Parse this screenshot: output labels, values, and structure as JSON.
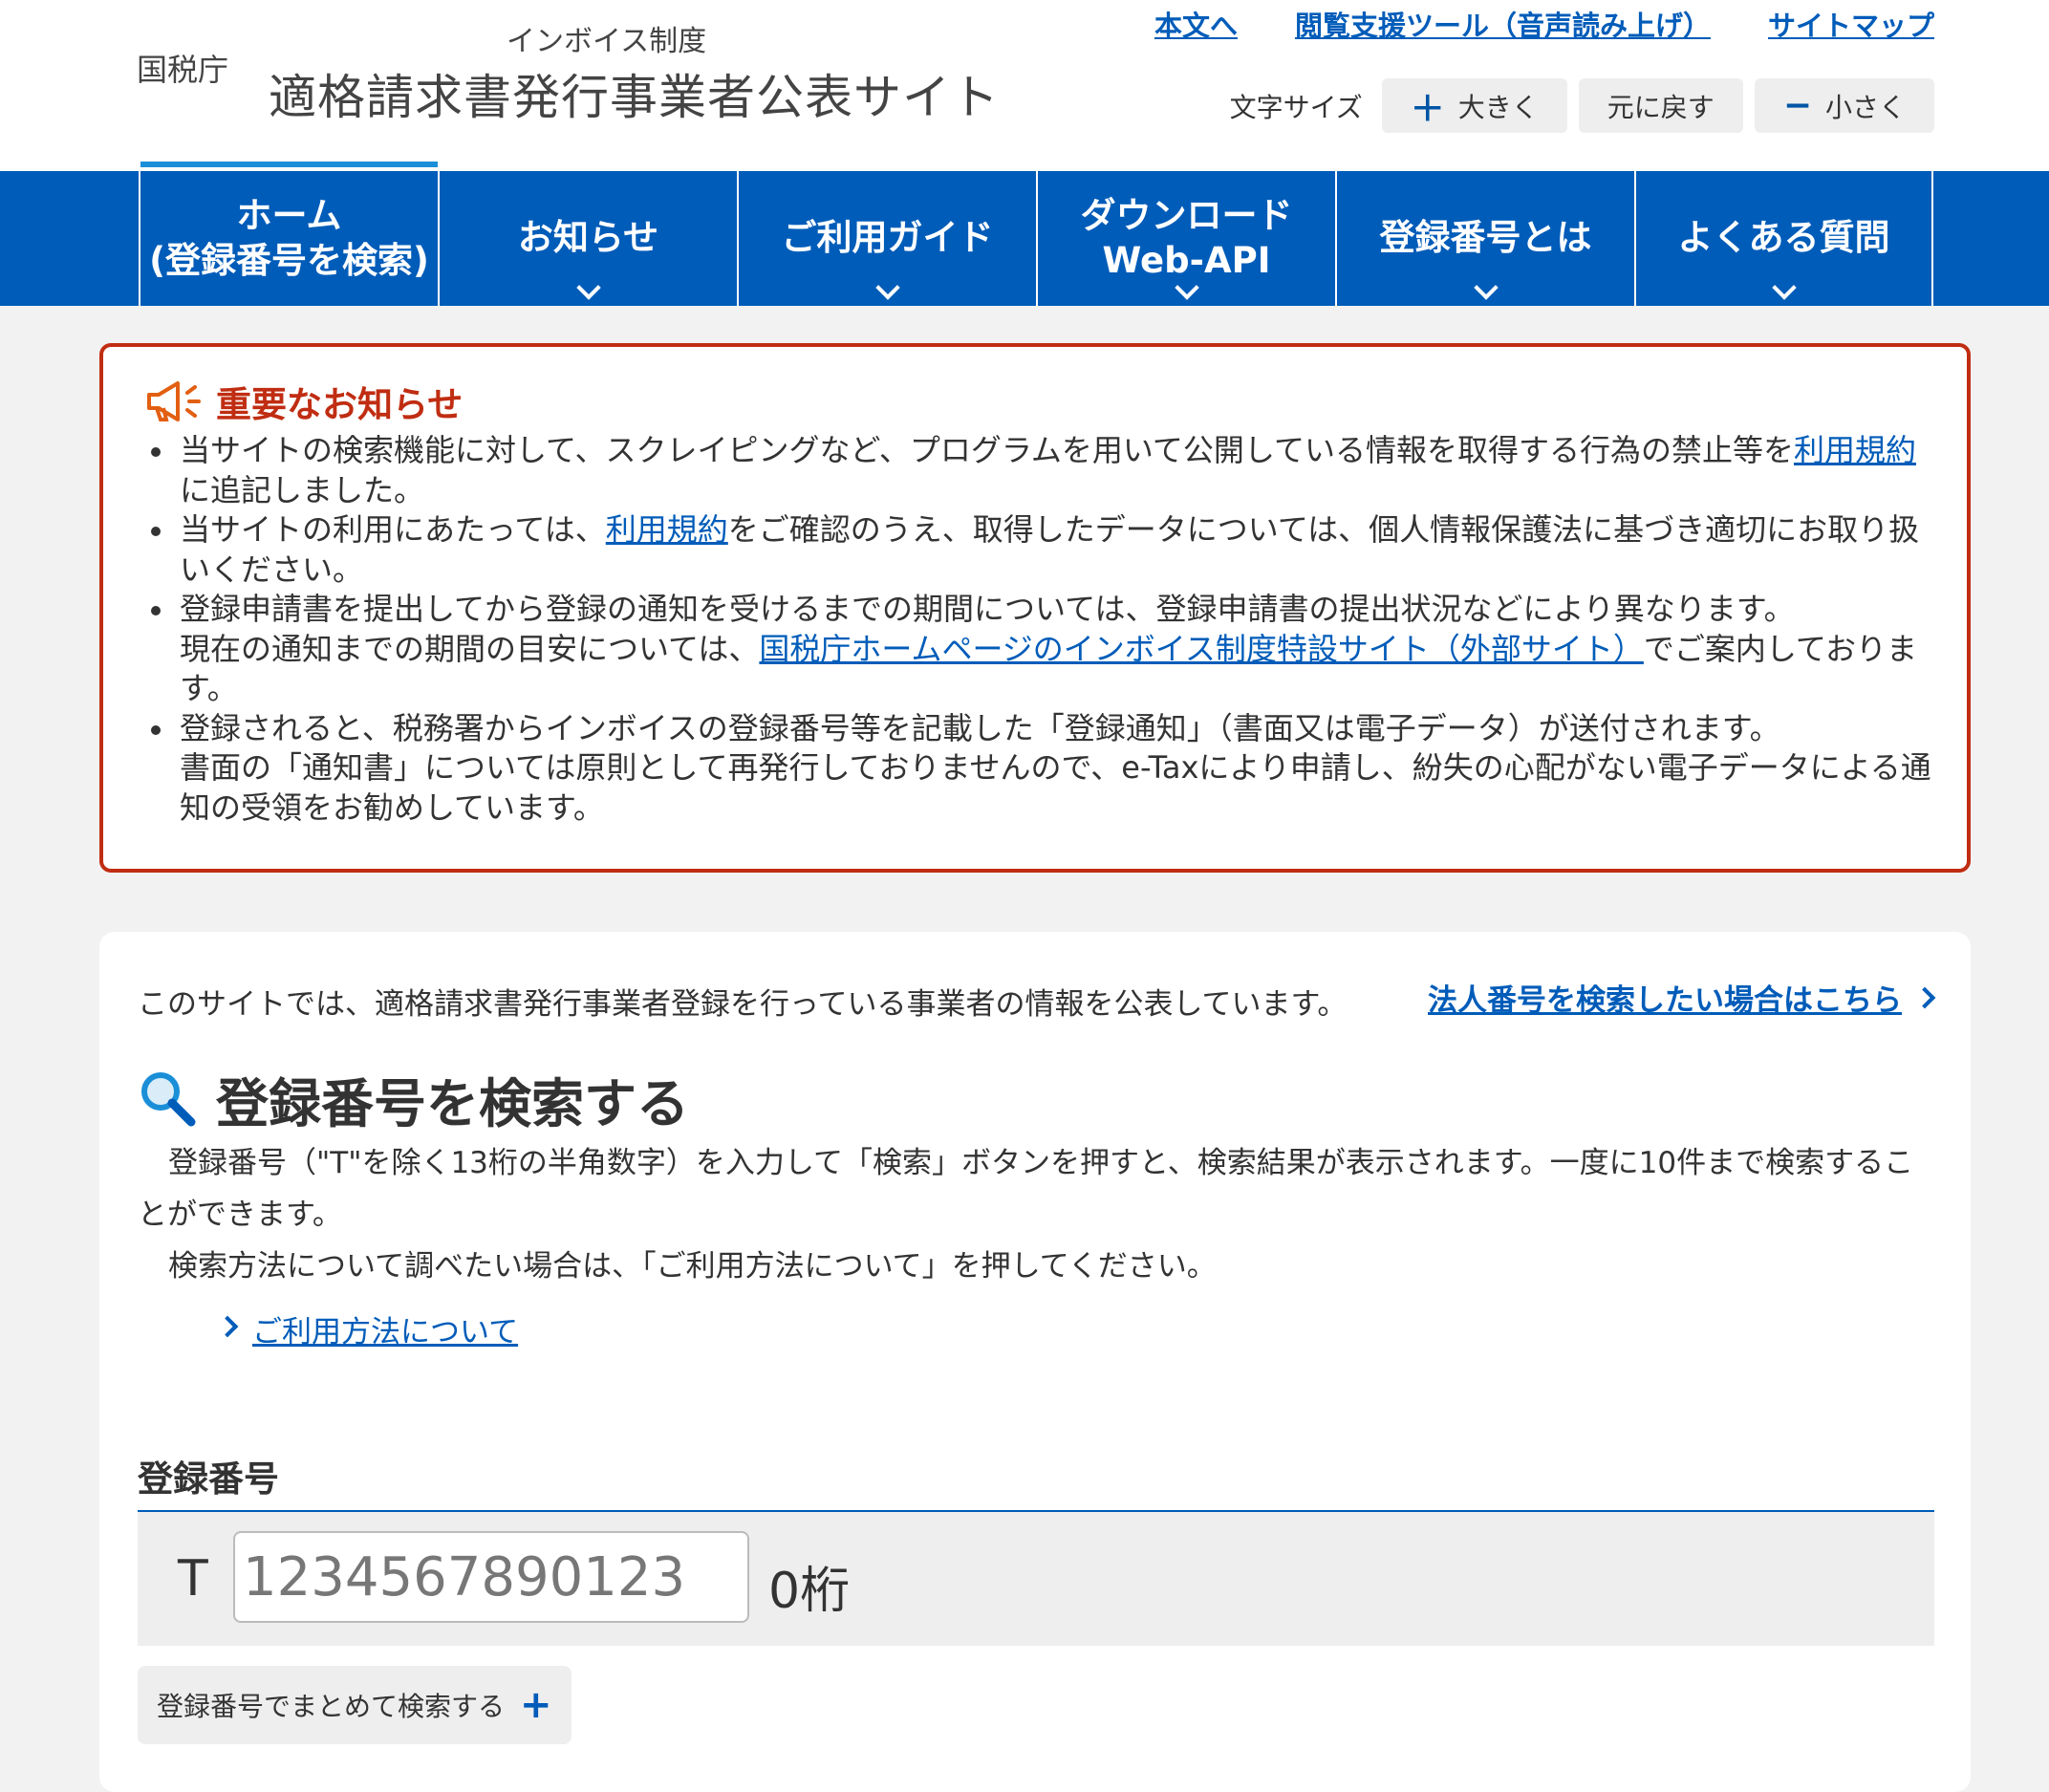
{
  "header": {
    "agency": "国税庁",
    "subtitle": "インボイス制度",
    "title": "適格請求書発行事業者公表サイト",
    "links": [
      "本文へ",
      "閲覧支援ツール（音声読み上げ）",
      "サイトマップ"
    ],
    "font_size": {
      "label": "文字サイズ",
      "larger": "大きく",
      "reset": "元に戻す",
      "smaller": "小さく"
    }
  },
  "nav": {
    "items": [
      {
        "line1": "ホーム",
        "line2": "(登録番号を検索)"
      },
      {
        "line1": "お知らせ",
        "line2": ""
      },
      {
        "line1": "ご利用ガイド",
        "line2": ""
      },
      {
        "line1": "ダウンロード",
        "line2": "Web-API"
      },
      {
        "line1": "登録番号とは",
        "line2": ""
      },
      {
        "line1": "よくある質問",
        "line2": ""
      }
    ]
  },
  "notice": {
    "title": "重要なお知らせ",
    "items": [
      {
        "pre": "当サイトの検索機能に対して、スクレイピングなど、プログラムを用いて公開している情報を取得する行為の禁止等を",
        "link": "利用規約",
        "post": "に追記しました。"
      },
      {
        "pre": "当サイトの利用にあたっては、",
        "link": "利用規約",
        "post": "をご確認のうえ、取得したデータについては、個人情報保護法に基づき適切にお取り扱いください。"
      },
      {
        "pre": "登録申請書を提出してから登録の通知を受けるまでの期間については、登録申請書の提出状況などにより異なります。",
        "pre2": "現在の通知までの期間の目安については、",
        "link": "国税庁ホームページのインボイス制度特設サイト（外部サイト）",
        "post": "でご案内しております。"
      },
      {
        "pre": "登録されると、税務署からインボイスの登録番号等を記載した「登録通知」（書面又は電子データ）が送付されます。",
        "pre2": "書面の「通知書」については原則として再発行しておりませんので、e-Taxにより申請し、紛失の心配がない電子データによる通知の受領をお勧めしています。"
      }
    ]
  },
  "main": {
    "intro": "このサイトでは、適格請求書発行事業者登録を行っている事業者の情報を公表しています。",
    "corp_link": "法人番号を検索したい場合はこちら",
    "search_heading": "登録番号を検索する",
    "desc1": "登録番号（\"T\"を除く13桁の半角数字）を入力して「検索」ボタンを押すと、検索結果が表示されます。一度に10件まで検索することができます。",
    "desc2": "検索方法について調べたい場合は、「ご利用方法について」を押してください。",
    "howto_link": "ご利用方法について",
    "reg_label": "登録番号",
    "reg_prefix": "T",
    "reg_placeholder": "1234567890123",
    "digit_count": "0桁",
    "bulk_button": "登録番号でまとめて検索する"
  },
  "colors": {
    "primary": "#005cb9",
    "alert": "#c02d12",
    "background": "#f2f2f2"
  }
}
